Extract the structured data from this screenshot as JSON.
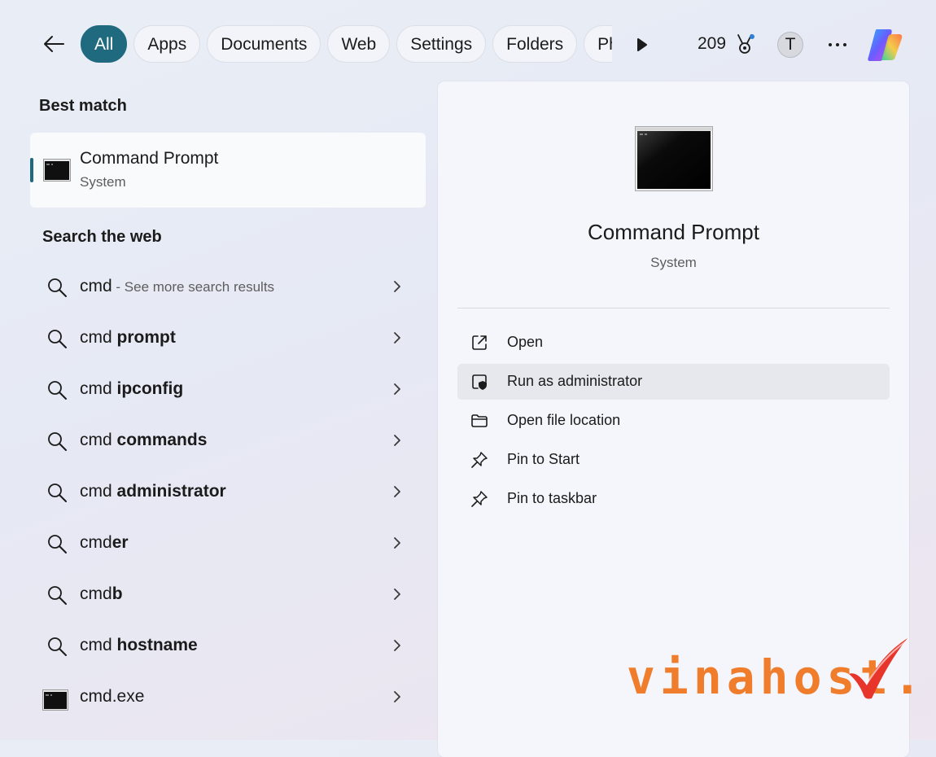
{
  "filter_bar": {
    "tabs": [
      {
        "label": "All",
        "active": true
      },
      {
        "label": "Apps",
        "active": false
      },
      {
        "label": "Documents",
        "active": false
      },
      {
        "label": "Web",
        "active": false
      },
      {
        "label": "Settings",
        "active": false
      },
      {
        "label": "Folders",
        "active": false
      },
      {
        "label": "Photos",
        "active": false
      }
    ],
    "points": "209",
    "avatar_letter": "T",
    "icons": [
      "back-arrow-icon",
      "play-icon",
      "trophy-icon",
      "more-icon",
      "copilot-icon"
    ]
  },
  "best_match": {
    "heading": "Best match",
    "title": "Command Prompt",
    "subtitle": "System"
  },
  "web": {
    "heading": "Search the web",
    "items": [
      {
        "prefix": "cmd",
        "bold": "",
        "hint": " - See more search results",
        "icon": "search-icon"
      },
      {
        "prefix": "cmd ",
        "bold": "prompt",
        "hint": "",
        "icon": "search-icon"
      },
      {
        "prefix": "cmd ",
        "bold": "ipconfig",
        "hint": "",
        "icon": "search-icon"
      },
      {
        "prefix": "cmd ",
        "bold": "commands",
        "hint": "",
        "icon": "search-icon"
      },
      {
        "prefix": "cmd ",
        "bold": "administrator",
        "hint": "",
        "icon": "search-icon"
      },
      {
        "prefix": "cmd",
        "bold": "er",
        "hint": "",
        "icon": "search-icon"
      },
      {
        "prefix": "cmd",
        "bold": "b",
        "hint": "",
        "icon": "search-icon"
      },
      {
        "prefix": "cmd ",
        "bold": "hostname",
        "hint": "",
        "icon": "search-icon"
      },
      {
        "prefix": "cmd",
        "bold": ".exe",
        "hint": "",
        "icon": "cmd-app-icon"
      }
    ]
  },
  "preview": {
    "title": "Command Prompt",
    "subtitle": "System",
    "actions": [
      {
        "label": "Open",
        "icon": "open-external-icon",
        "hovered": false
      },
      {
        "label": "Run as administrator",
        "icon": "admin-shield-icon",
        "hovered": true
      },
      {
        "label": "Open file location",
        "icon": "folder-icon",
        "hovered": false
      },
      {
        "label": "Pin to Start",
        "icon": "pin-icon",
        "hovered": false
      },
      {
        "label": "Pin to taskbar",
        "icon": "pin-icon",
        "hovered": false
      }
    ]
  },
  "watermark": {
    "text": "vinahost."
  },
  "colors": {
    "accent": "#1f6a7e",
    "watermark": "#ef7d2c",
    "watermark_check": "#e8352b"
  }
}
